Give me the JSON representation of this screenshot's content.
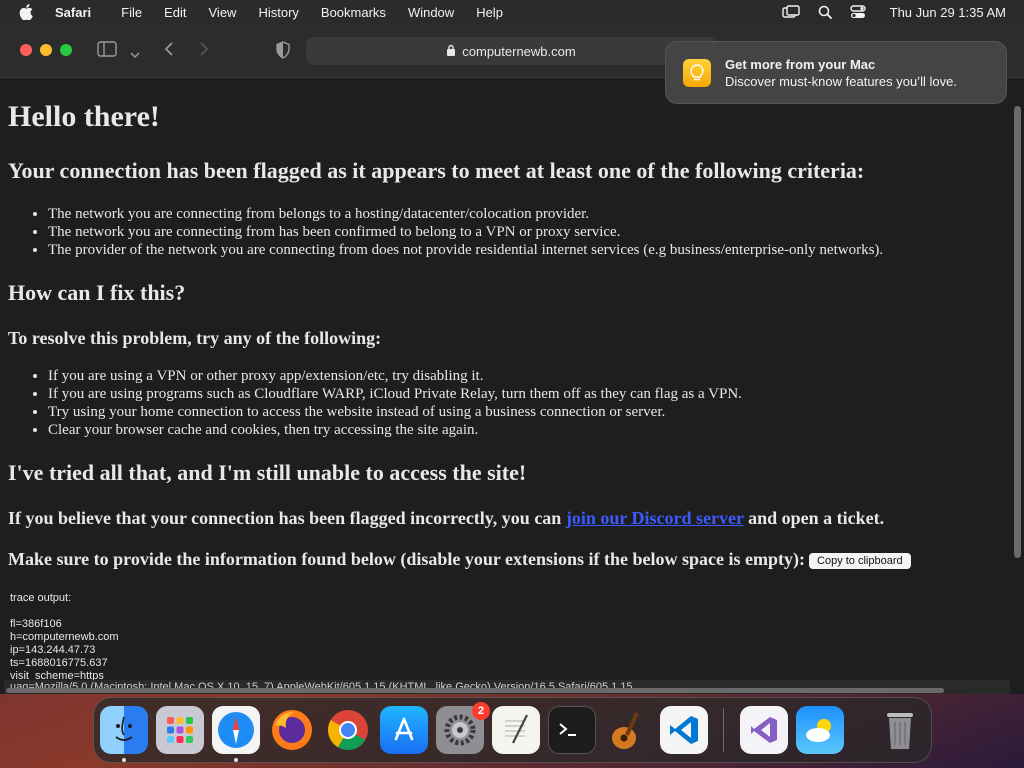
{
  "menubar": {
    "app_name": "Safari",
    "items": [
      "File",
      "Edit",
      "View",
      "History",
      "Bookmarks",
      "Window",
      "Help"
    ],
    "clock": "Thu Jun 29  1:35 AM"
  },
  "browser": {
    "address": "computernewb.com"
  },
  "notification": {
    "title": "Get more from your Mac",
    "body": "Discover must-know features you’ll love."
  },
  "page": {
    "h1": "Hello there!",
    "flagged_heading": "Your connection has been flagged as it appears to meet at least one of the following criteria:",
    "criteria": [
      "The network you are connecting from belongs to a hosting/datacenter/colocation provider.",
      "The network you are connecting from has been confirmed to belong to a VPN or proxy service.",
      "The provider of the network you are connecting from does not provide residential internet services (e.g business/enterprise-only networks)."
    ],
    "fix_heading": "How can I fix this?",
    "resolve_heading": "To resolve this problem, try any of the following:",
    "fixes": [
      "If you are using a VPN or other proxy app/extension/etc, try disabling it.",
      "If you are using programs such as Cloudflare WARP, iCloud Private Relay, turn them off as they can flag as a VPN.",
      "Try using your home connection to access the website instead of using a business connection or server.",
      "Clear your browser cache and cookies, then try accessing the site again."
    ],
    "tried_heading": "I've tried all that, and I'm still unable to access the site!",
    "believe_prefix": "If you believe that your connection has been flagged incorrectly, you can ",
    "discord_link": "join our Discord server",
    "believe_suffix": " and open a ticket.",
    "provide_info": "Make sure to provide the information found below (disable your extensions if the below space is empty):",
    "copy_button": "Copy to clipboard",
    "trace_label": "trace output:",
    "trace_lines": [
      "fl=386f106",
      "h=computernewb.com",
      "ip=143.244.47.73",
      "ts=1688016775.637",
      "visit_scheme=https"
    ],
    "uag_line": "uag=Mozilla/5.0 (Macintosh; Intel Mac OS X 10_15_7) AppleWebKit/605.1.15 (KHTML, like Gecko) Version/16.5 Safari/605.1.15"
  },
  "dock": {
    "apps": [
      {
        "name": "Finder",
        "icon": "finder-icon",
        "running": true
      },
      {
        "name": "Launchpad",
        "icon": "launchpad-icon",
        "running": false
      },
      {
        "name": "Safari",
        "icon": "safari-icon",
        "running": true
      },
      {
        "name": "Firefox",
        "icon": "firefox-icon",
        "running": false
      },
      {
        "name": "Chrome",
        "icon": "chrome-icon",
        "running": false
      },
      {
        "name": "App Store",
        "icon": "app-store-icon",
        "running": false
      },
      {
        "name": "System Settings",
        "icon": "system-settings-icon",
        "running": false,
        "badge": "2"
      },
      {
        "name": "TextEdit",
        "icon": "textedit-icon",
        "running": false
      },
      {
        "name": "Terminal",
        "icon": "terminal-icon",
        "running": false
      },
      {
        "name": "GarageBand",
        "icon": "garageband-icon",
        "running": false
      },
      {
        "name": "VS Code",
        "icon": "vscode-icon",
        "running": false
      },
      {
        "name": "Visual Studio",
        "icon": "visual-studio-icon",
        "running": false
      },
      {
        "name": "Weather",
        "icon": "weather-icon",
        "running": false
      },
      {
        "name": "Trash",
        "icon": "trash-icon",
        "running": false
      }
    ]
  }
}
